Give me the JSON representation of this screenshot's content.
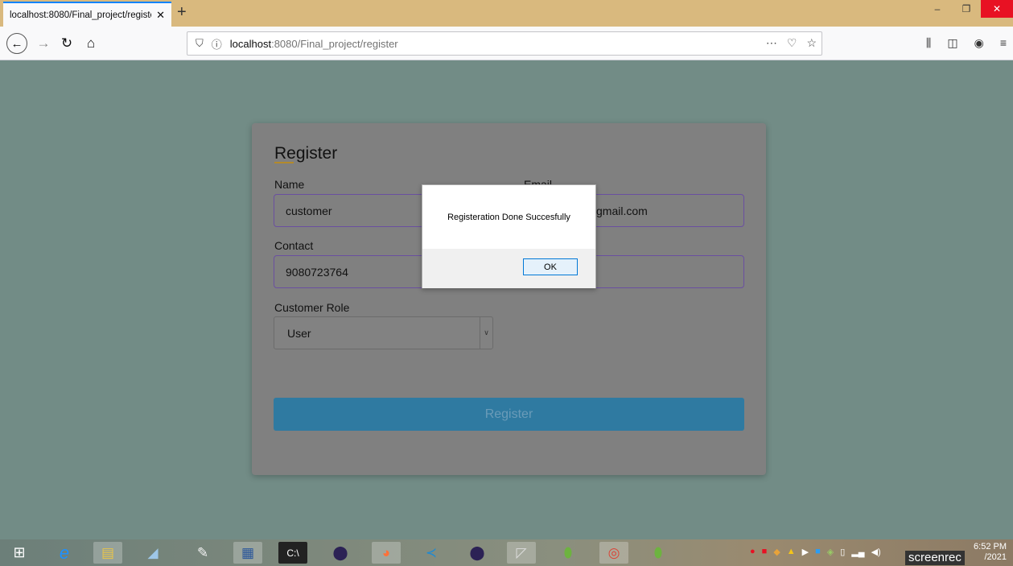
{
  "browser": {
    "tab_title": "localhost:8080/Final_project/registe",
    "tab_close": "✕",
    "new_tab": "+",
    "url_host": "localhost",
    "url_path": ":8080/Final_project/register",
    "win_min": "–",
    "win_max": "❐",
    "win_close": "✕"
  },
  "form": {
    "title": "Register",
    "name_label": "Name",
    "name_value": "customer",
    "email_label": "Email",
    "email_value_visible": "gmail.com",
    "contact_label": "Contact",
    "contact_value": "9080723764",
    "role_label": "Customer Role",
    "role_value": "User",
    "submit_label": "Register"
  },
  "dialog": {
    "message": "Registeration Done Succesfully",
    "ok_label": "OK"
  },
  "taskbar": {
    "time": "6:52 PM",
    "date_partial": "/2021",
    "overlay_text": "screenrec"
  }
}
